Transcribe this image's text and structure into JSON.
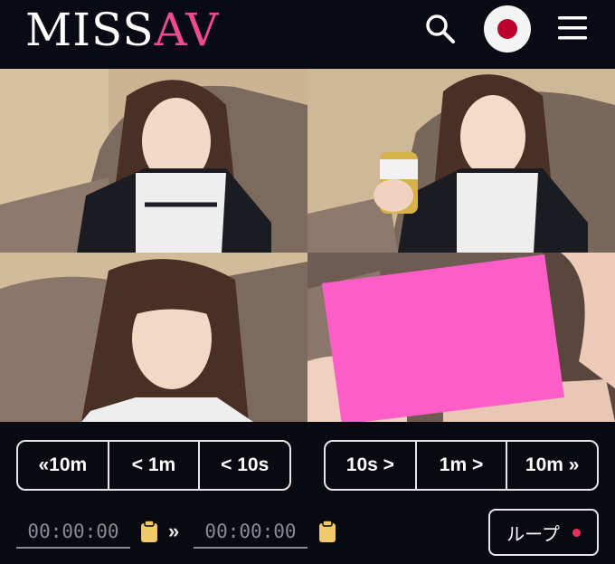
{
  "header": {
    "logo_part1": "MISS",
    "logo_part2": "AV",
    "icons": {
      "search": "search-icon",
      "language": "japan-flag-icon",
      "menu": "hamburger-menu-icon"
    }
  },
  "colors": {
    "logo_accent": "#ec4c8f",
    "flag_red": "#bc002d",
    "loop_dot": "#e8305a",
    "censor": "#ff5ec8"
  },
  "seek_back": [
    "«10m",
    "< 1m",
    "< 10s"
  ],
  "seek_forward": [
    "10s >",
    "1m >",
    "10m »"
  ],
  "range": {
    "start_value": "00:00:00",
    "end_value": "00:00:00",
    "separator": "»"
  },
  "loop_label": "ループ"
}
